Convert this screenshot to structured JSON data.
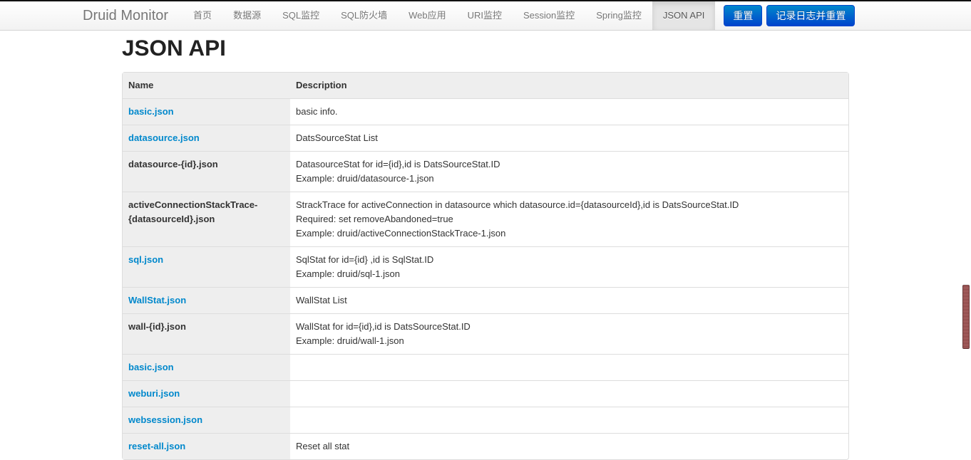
{
  "brand": "Druid Monitor",
  "nav": [
    {
      "label": "首页"
    },
    {
      "label": "数据源"
    },
    {
      "label": "SQL监控"
    },
    {
      "label": "SQL防火墙"
    },
    {
      "label": "Web应用"
    },
    {
      "label": "URI监控"
    },
    {
      "label": "Session监控"
    },
    {
      "label": "Spring监控"
    },
    {
      "label": "JSON API",
      "active": true
    }
  ],
  "buttons": {
    "reset": "重置",
    "log_reset": "记录日志并重置"
  },
  "page_title": "JSON API",
  "columns": {
    "name": "Name",
    "description": "Description"
  },
  "rows": [
    {
      "name": "basic.json",
      "link": true,
      "desc": "basic info."
    },
    {
      "name": "datasource.json",
      "link": true,
      "desc": "DatsSourceStat List"
    },
    {
      "name": "datasource-{id}.json",
      "link": false,
      "desc": "DatasourceStat for id={id},id is DatsSourceStat.ID\nExample: druid/datasource-1.json"
    },
    {
      "name": "activeConnectionStackTrace-{datasourceId}.json",
      "link": false,
      "desc": "StrackTrace for activeConnection in datasource which datasource.id={datasourceId},id is DatsSourceStat.ID\nRequired: set removeAbandoned=true\nExample: druid/activeConnectionStackTrace-1.json"
    },
    {
      "name": "sql.json",
      "link": true,
      "desc": "SqlStat for id={id} ,id is SqlStat.ID\nExample: druid/sql-1.json"
    },
    {
      "name": "WallStat.json",
      "link": true,
      "desc": "WallStat List"
    },
    {
      "name": "wall-{id}.json",
      "link": false,
      "desc": "WallStat for id={id},id is DatsSourceStat.ID\nExample: druid/wall-1.json"
    },
    {
      "name": "basic.json",
      "link": true,
      "desc": ""
    },
    {
      "name": "weburi.json",
      "link": true,
      "desc": ""
    },
    {
      "name": "websession.json",
      "link": true,
      "desc": ""
    },
    {
      "name": "reset-all.json",
      "link": true,
      "desc": "Reset all stat"
    }
  ]
}
